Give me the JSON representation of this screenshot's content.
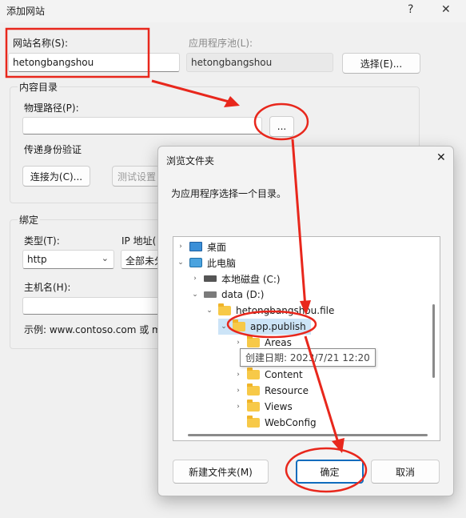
{
  "window": {
    "title": "添加网站",
    "help_glyph": "?",
    "close_glyph": "✕"
  },
  "site": {
    "name_label": "网站名称(S):",
    "name_value": "hetongbangshou",
    "pool_label": "应用程序池(L):",
    "pool_value": "hetongbangshou",
    "select_button": "选择(E)..."
  },
  "content": {
    "group_label": "内容目录",
    "path_label": "物理路径(P):",
    "path_value": "",
    "browse_button": "...",
    "auth_label": "传递身份验证",
    "connect_button": "连接为(C)...",
    "test_button": "测试设置"
  },
  "binding": {
    "group_label": "绑定",
    "type_label": "类型(T):",
    "type_value": "http",
    "ip_label": "IP 地址(",
    "ip_value": "全部未分",
    "host_label": "主机名(H):",
    "host_value": "",
    "example": "示例: www.contoso.com 或 m"
  },
  "dialog": {
    "title": "浏览文件夹",
    "close_glyph": "✕",
    "instruction": "为应用程序选择一个目录。",
    "tree": [
      {
        "label": "桌面",
        "expander": "›",
        "icon": "desktop-icon"
      },
      {
        "label": "此电脑",
        "expander": "⌄",
        "icon": "computer-icon"
      },
      {
        "label": "本地磁盘 (C:)",
        "expander": "›",
        "icon": "drive-icon"
      },
      {
        "label": "data (D:)",
        "expander": "⌄",
        "icon": "drive-icon"
      },
      {
        "label": "hetongbangshou.file",
        "expander": "⌄",
        "icon": "folder-icon"
      },
      {
        "label": "app.publish",
        "expander": "⌄",
        "icon": "folder-icon"
      },
      {
        "label": "Areas",
        "expander": "›",
        "icon": "folder-icon"
      },
      {
        "label": "Content",
        "expander": "›",
        "icon": "folder-icon"
      },
      {
        "label": "Resource",
        "expander": "›",
        "icon": "folder-icon"
      },
      {
        "label": "Views",
        "expander": "›",
        "icon": "folder-icon"
      },
      {
        "label": "WebConfig",
        "expander": "",
        "icon": "folder-icon"
      }
    ],
    "tooltip": "创建日期: 2023/7/21 12:20",
    "new_folder_button": "新建文件夹(M)",
    "ok_button": "确定",
    "cancel_button": "取消"
  },
  "colors": {
    "annotation_red": "#e8271c",
    "accent_blue": "#0f6cbd",
    "selection": "#cce4f7"
  }
}
